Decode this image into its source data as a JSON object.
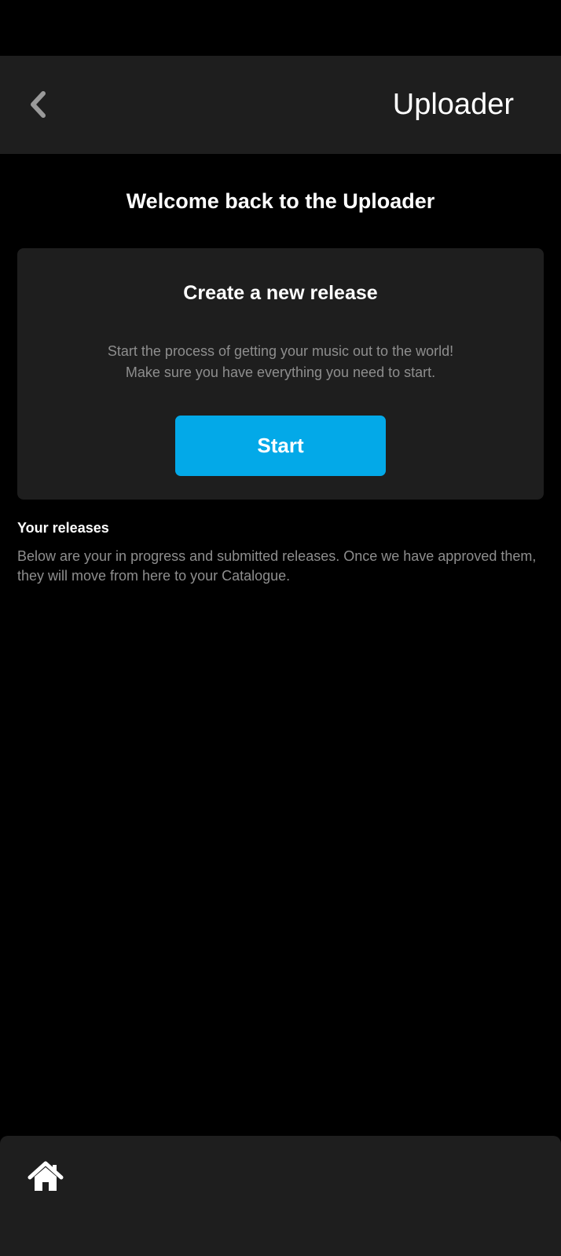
{
  "app_bar": {
    "title": "Uploader",
    "back_icon": "chevron-left-icon"
  },
  "welcome": {
    "heading": "Welcome back to the Uploader"
  },
  "create_card": {
    "title": "Create a new release",
    "description_line1": "Start the process of getting your music out to the world!",
    "description_line2": "Make sure you have everything you need to start.",
    "start_label": "Start"
  },
  "releases": {
    "heading": "Your releases",
    "description": "Below are your in progress and submitted releases. Once we have approved them, they will move from here to your Catalogue."
  },
  "bottom_nav": {
    "home_icon": "home-icon"
  },
  "colors": {
    "background": "#000000",
    "surface": "#1e1e1e",
    "accent": "#03a9e8",
    "text_primary": "#ffffff",
    "text_secondary": "#8e8e8e"
  }
}
